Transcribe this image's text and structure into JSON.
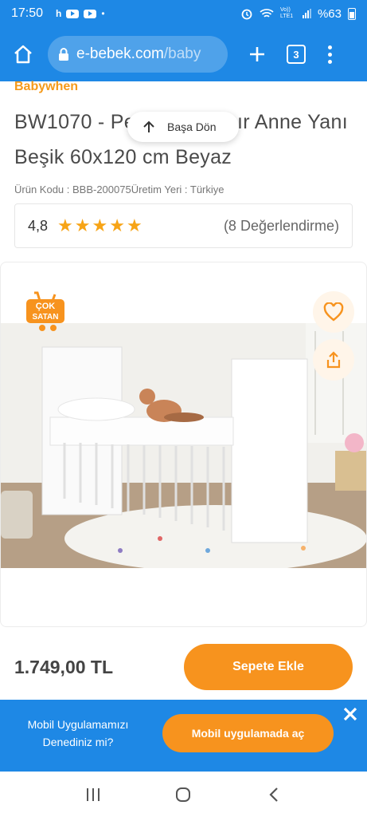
{
  "status_bar": {
    "time": "17:50",
    "notif_letter": "h",
    "network_label": "Vo)) LTE1",
    "battery": "%63"
  },
  "browser": {
    "url_main": "e-bebek.com",
    "url_tail": "/baby",
    "tab_count": "3"
  },
  "product": {
    "brand": "Babywhen",
    "title": "BW1070 - Pembe Sallanır Anne Yanı Beşik 60x120 cm Beyaz",
    "code_line": "Ürün Kodu : BBB-200075Üretim Yeri : Türkiye",
    "rating": "4,8",
    "star_count": 5,
    "review_count": "(8 Değerlendirme)",
    "badge_line1": "ÇOK",
    "badge_line2": "SATAN"
  },
  "back_to_top": {
    "label": "Başa Dön"
  },
  "purchase": {
    "price": "1.749,00 TL",
    "add_to_cart": "Sepete Ekle"
  },
  "app_banner": {
    "text": "Mobil Uygulamamızı Denediniz mi?",
    "button": "Mobil uygulamada aç"
  },
  "colors": {
    "primary_blue": "#1e88e5",
    "accent_orange": "#f7931e",
    "brand_orange": "#f59a1a",
    "star": "#f7a416"
  },
  "icons": {
    "home": "home-icon",
    "lock": "lock-icon",
    "plus": "plus-icon",
    "tabs": "tabs-icon",
    "menu": "more-vert-icon",
    "up": "arrow-up-icon",
    "heart": "heart-icon",
    "share": "share-icon",
    "close": "close-icon"
  }
}
